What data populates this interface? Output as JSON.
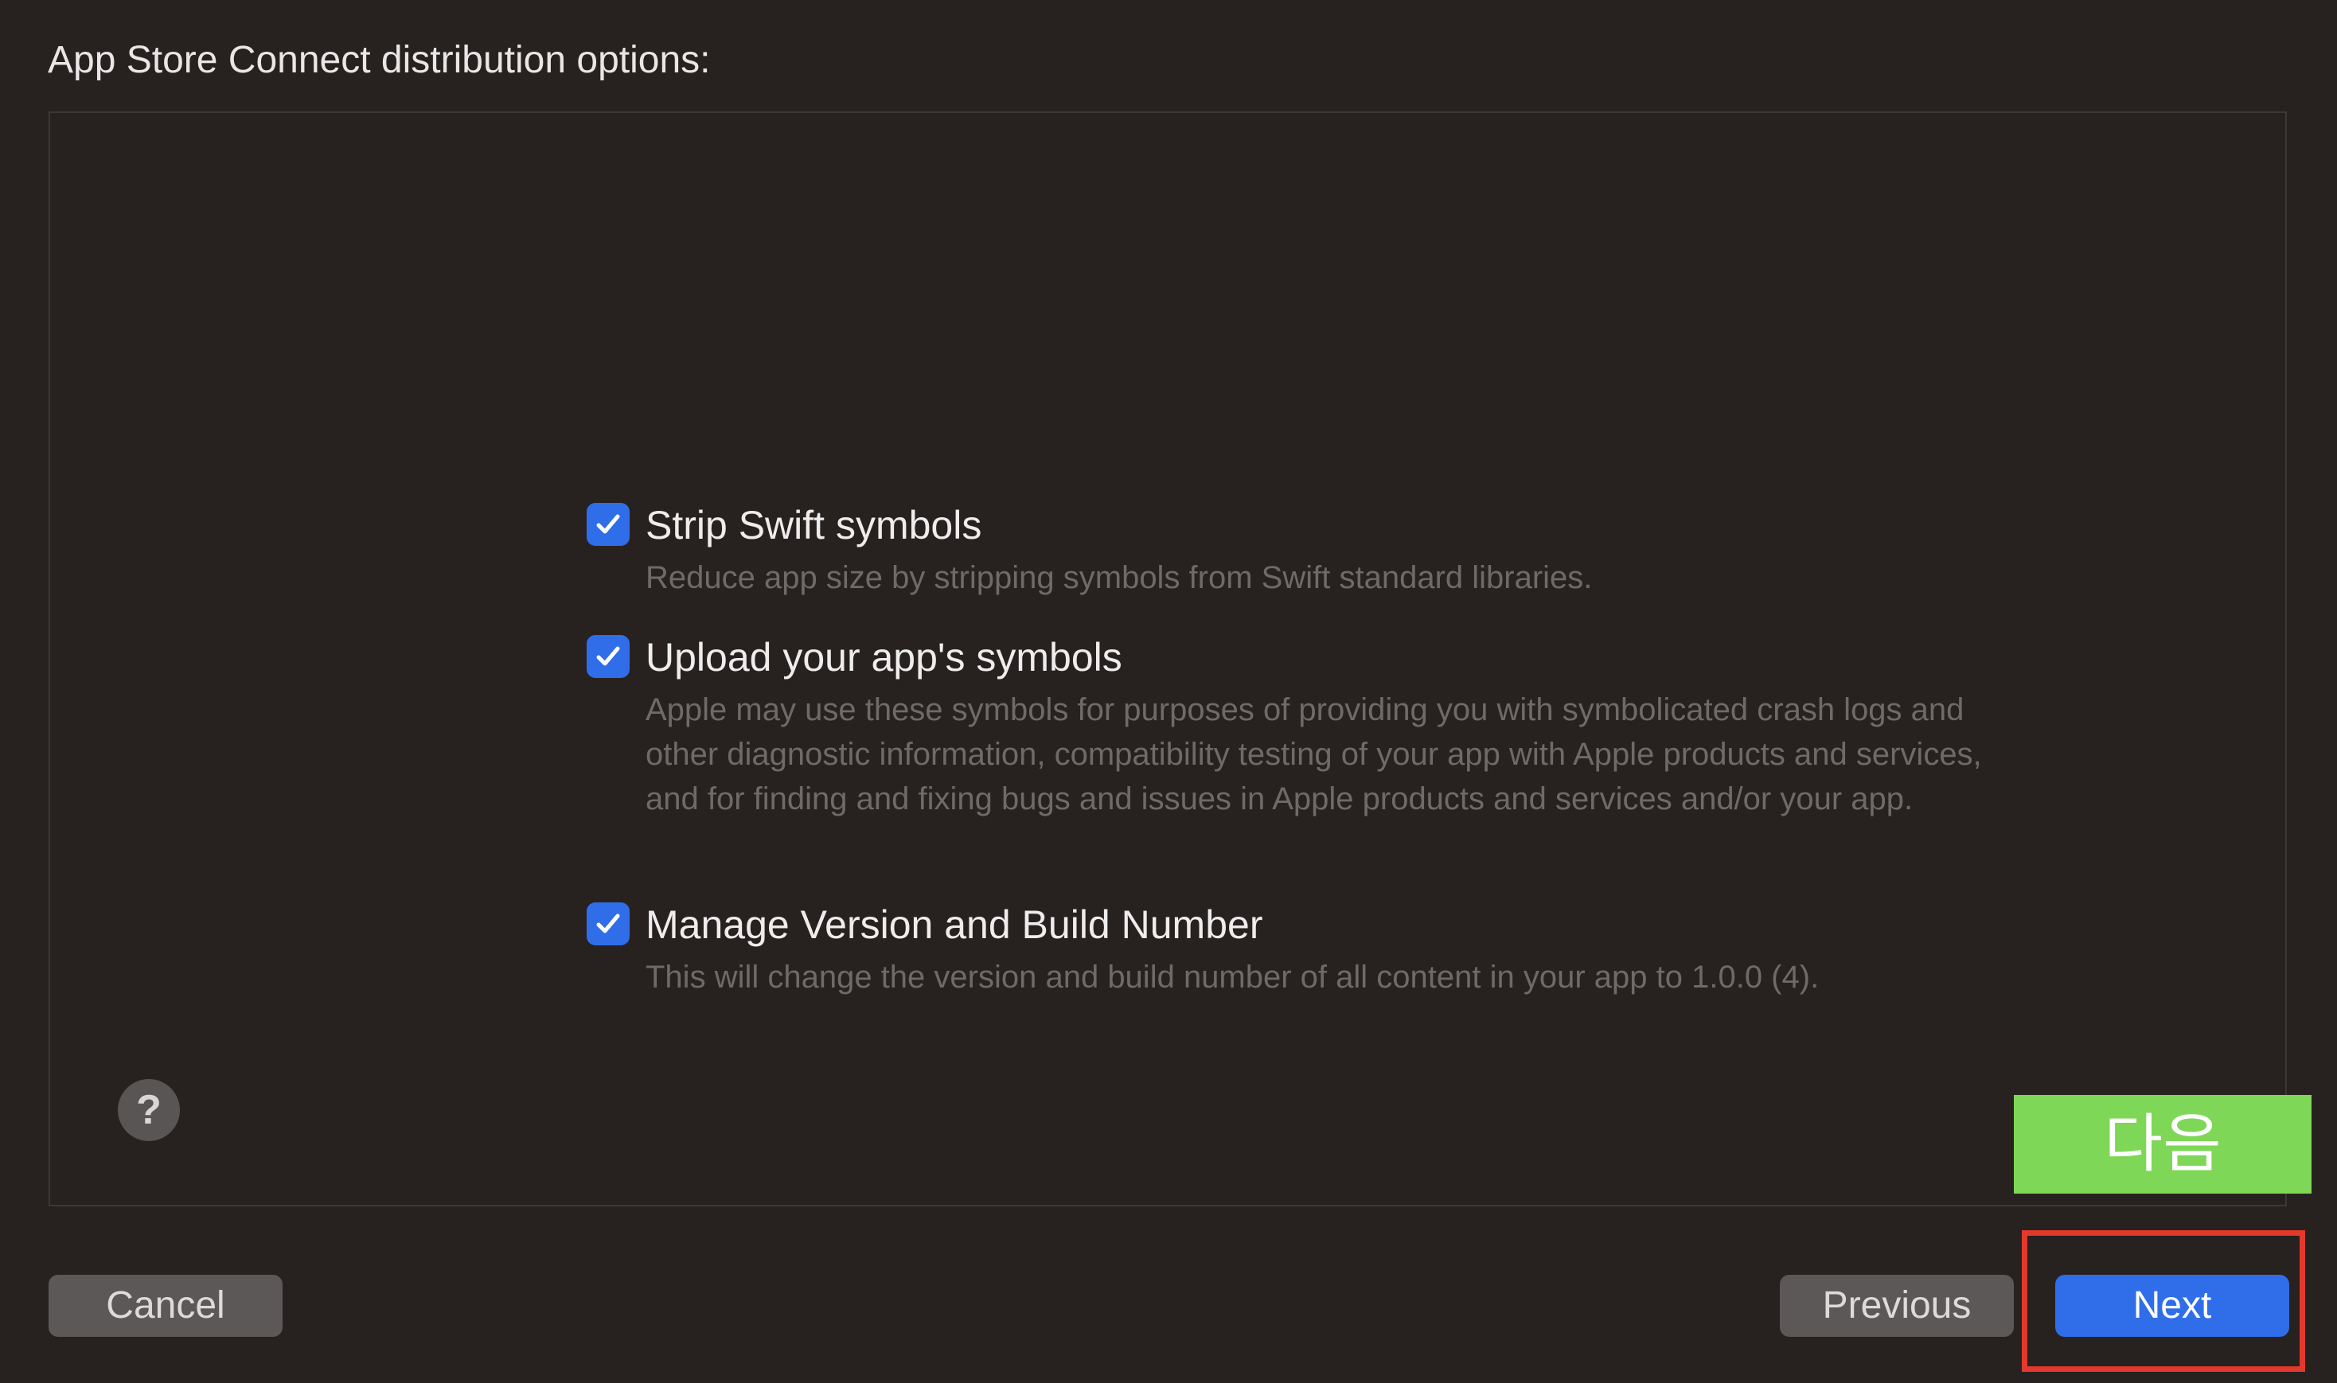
{
  "dialog": {
    "title": "App Store Connect distribution options:"
  },
  "options": [
    {
      "label": "Strip Swift symbols",
      "description": "Reduce app size by stripping symbols from Swift standard libraries.",
      "checked": true
    },
    {
      "label": "Upload your app's symbols",
      "description": "Apple may use these symbols for purposes of providing you with symbolicated crash logs and other diagnostic information, compatibility testing of your app with Apple products and services, and for finding and fixing bugs and issues in Apple products and services and/or your app.",
      "checked": true
    },
    {
      "label": "Manage Version and Build Number",
      "description": "This will change the version and build number of all content in your app to 1.0.0 (4).",
      "checked": true
    }
  ],
  "help": {
    "label": "?"
  },
  "annotation": {
    "next_ko": "다음",
    "highlight_color": "#e2392c",
    "badge_color": "#7ed756"
  },
  "buttons": {
    "cancel": "Cancel",
    "previous": "Previous",
    "next": "Next"
  },
  "colors": {
    "background": "#272120",
    "accent": "#2f6ee8"
  }
}
